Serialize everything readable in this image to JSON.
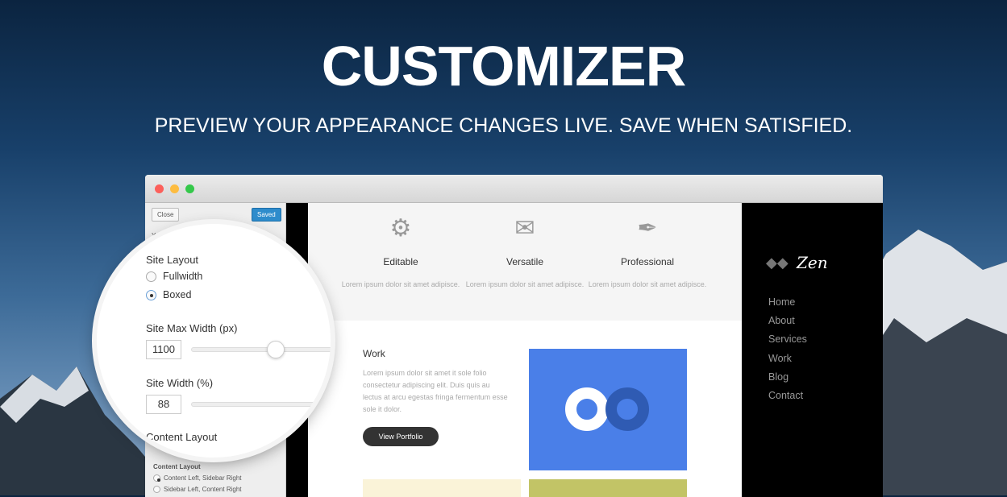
{
  "hero": {
    "title": "CUSTOMIZER",
    "subtitle": "PREVIEW YOUR APPEARANCE CHANGES LIVE. SAVE WHEN SATISFIED."
  },
  "window": {
    "traffic_lights": [
      "#fc605b",
      "#fdbc40",
      "#34c84a"
    ]
  },
  "customizer": {
    "close_label": "Close",
    "saved_label": "Saved",
    "info_text": "You are ...",
    "site_layout_label": "Site Layout",
    "site_layout_options": [
      "Fullwidth",
      "Boxed"
    ],
    "site_layout_selected": "Boxed",
    "max_width_label": "Site Max Width (px)",
    "max_width_value": "1100",
    "site_width_label": "Site Width (%)",
    "site_width_value": "88",
    "content_layout_heading": "Content Layout",
    "content_layout_label": "Content Layout",
    "content_layout_options": [
      "Content Left, Sidebar Right",
      "Sidebar Left, Content Right"
    ],
    "content_layout_selected": "Content Left, Sidebar Right",
    "saved_color": "#2e8ccc"
  },
  "preview": {
    "features": [
      {
        "icon": "gear-icon",
        "title": "Editable",
        "text": "Lorem ipsum dolor sit amet adipisce."
      },
      {
        "icon": "envelope-icon",
        "title": "Versatile",
        "text": "Lorem ipsum dolor sit amet adipisce."
      },
      {
        "icon": "pen-icon",
        "title": "Professional",
        "text": "Lorem ipsum dolor sit amet adipisce."
      }
    ],
    "work": {
      "title": "Work",
      "text": "Lorem ipsum dolor sit amet it sole folio consectetur adipiscing elit. Duis quis au lectus at arcu egestas fringa fermentum esse sole it dolor.",
      "button": "View Portfolio",
      "image_color": "#4a7fe8"
    },
    "logo": "Zen",
    "nav": [
      "Home",
      "About",
      "Services",
      "Work",
      "Blog",
      "Contact"
    ]
  }
}
